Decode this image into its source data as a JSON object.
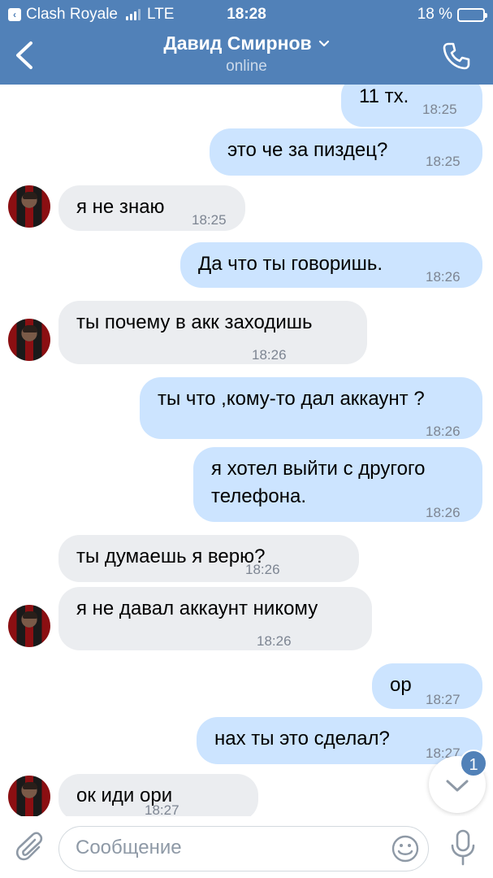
{
  "status_bar": {
    "app": "Clash Royale",
    "network": "LTE",
    "time": "18:28",
    "battery": "18 %",
    "battery_level": 0.18
  },
  "header": {
    "title": "Давид Смирнов",
    "subtitle": "online",
    "accent_color": "#5181b8"
  },
  "messages": [
    {
      "direction": "out",
      "text": "11 тх.",
      "time": "18:25"
    },
    {
      "direction": "out",
      "text": "это че за пиздец?",
      "time": "18:25"
    },
    {
      "direction": "in",
      "text": "я не знаю",
      "time": "18:25"
    },
    {
      "direction": "out",
      "text": "Да что ты говоришь.",
      "time": "18:26"
    },
    {
      "direction": "in",
      "text": "ты почему в акк заходишь",
      "time": "18:26"
    },
    {
      "direction": "out",
      "text": "ты что ,кому-то дал аккаунт ?",
      "time": "18:26"
    },
    {
      "direction": "out",
      "text": "я хотел выйти с другого\nтелефона.",
      "time": "18:26"
    },
    {
      "direction": "in",
      "text": "ты думаешь я верю?",
      "time": "18:26"
    },
    {
      "direction": "in",
      "text": "я не давал аккаунт никому",
      "time": "18:26"
    },
    {
      "direction": "out",
      "text": "ор",
      "time": "18:27"
    },
    {
      "direction": "out",
      "text": "нах ты это сделал?",
      "time": "18:27"
    },
    {
      "direction": "in",
      "text": "ок иди ори",
      "time": "18:27"
    }
  ],
  "scroll_down": {
    "badge": "1"
  },
  "composer": {
    "placeholder": "Сообщение"
  },
  "colors": {
    "outgoing_bubble": "#cce4ff",
    "incoming_bubble": "#ebedf0",
    "time_text": "#7d8592"
  }
}
